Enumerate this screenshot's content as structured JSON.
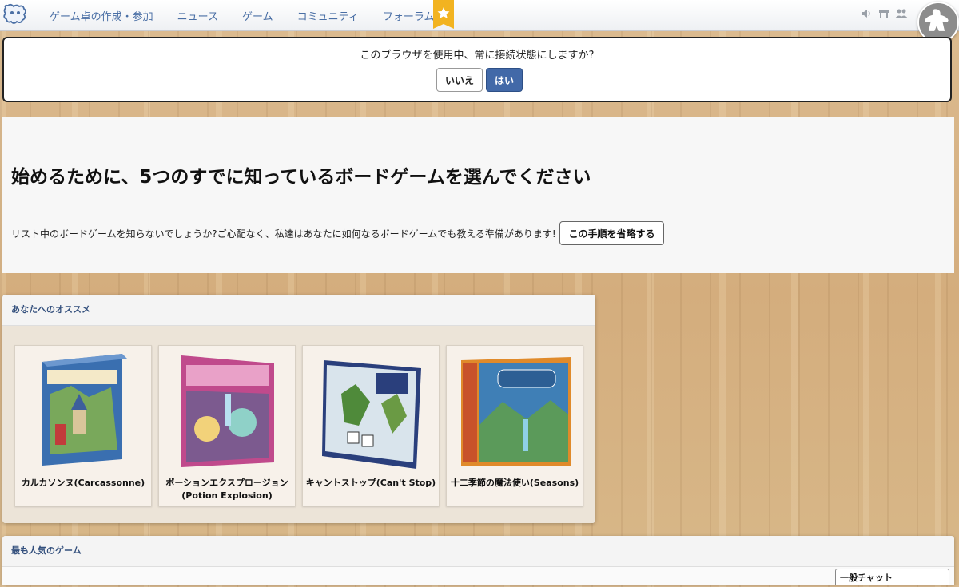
{
  "nav": {
    "items": [
      "ゲーム卓の作成・参加",
      "ニュース",
      "ゲーム",
      "コミュニティ",
      "フォーラム"
    ],
    "icons": [
      "logo-icon",
      "star-icon",
      "speaker-icon",
      "table-icon",
      "group-icon",
      "meeple-icon"
    ]
  },
  "prompt": {
    "question": "このブラウザを使用中、常に接続状態にしますか?",
    "no_label": "いいえ",
    "yes_label": "はい"
  },
  "intro": {
    "title": "始めるために、5つのすでに知っているボードゲームを選んでください",
    "subtitle": "リスト中のボードゲームを知らないでしょうか?ご心配なく、私達はあなたに如何なるボードゲームでも教える準備があります!",
    "skip_label": "この手順を省略する"
  },
  "recommended": {
    "header": "あなたへのオススメ",
    "games": [
      {
        "name": "カルカソンヌ(Carcassonne)",
        "box_color": "#3a6fb0"
      },
      {
        "name": "ポーションエクスプロージョン(Potion Explosion)",
        "box_color": "#c04a8c"
      },
      {
        "name": "キャントストップ(Can't Stop)",
        "box_color": "#2a3f7c"
      },
      {
        "name": "十二季節の魔法使い(Seasons)",
        "box_color": "#e08a2a"
      }
    ]
  },
  "popular": {
    "header": "最も人気のゲーム"
  },
  "chat": {
    "label": "一般チャット"
  },
  "colors": {
    "accent_blue": "#4269a8",
    "nav_link": "#4a6fa5",
    "panel_header_text": "#34507d"
  }
}
